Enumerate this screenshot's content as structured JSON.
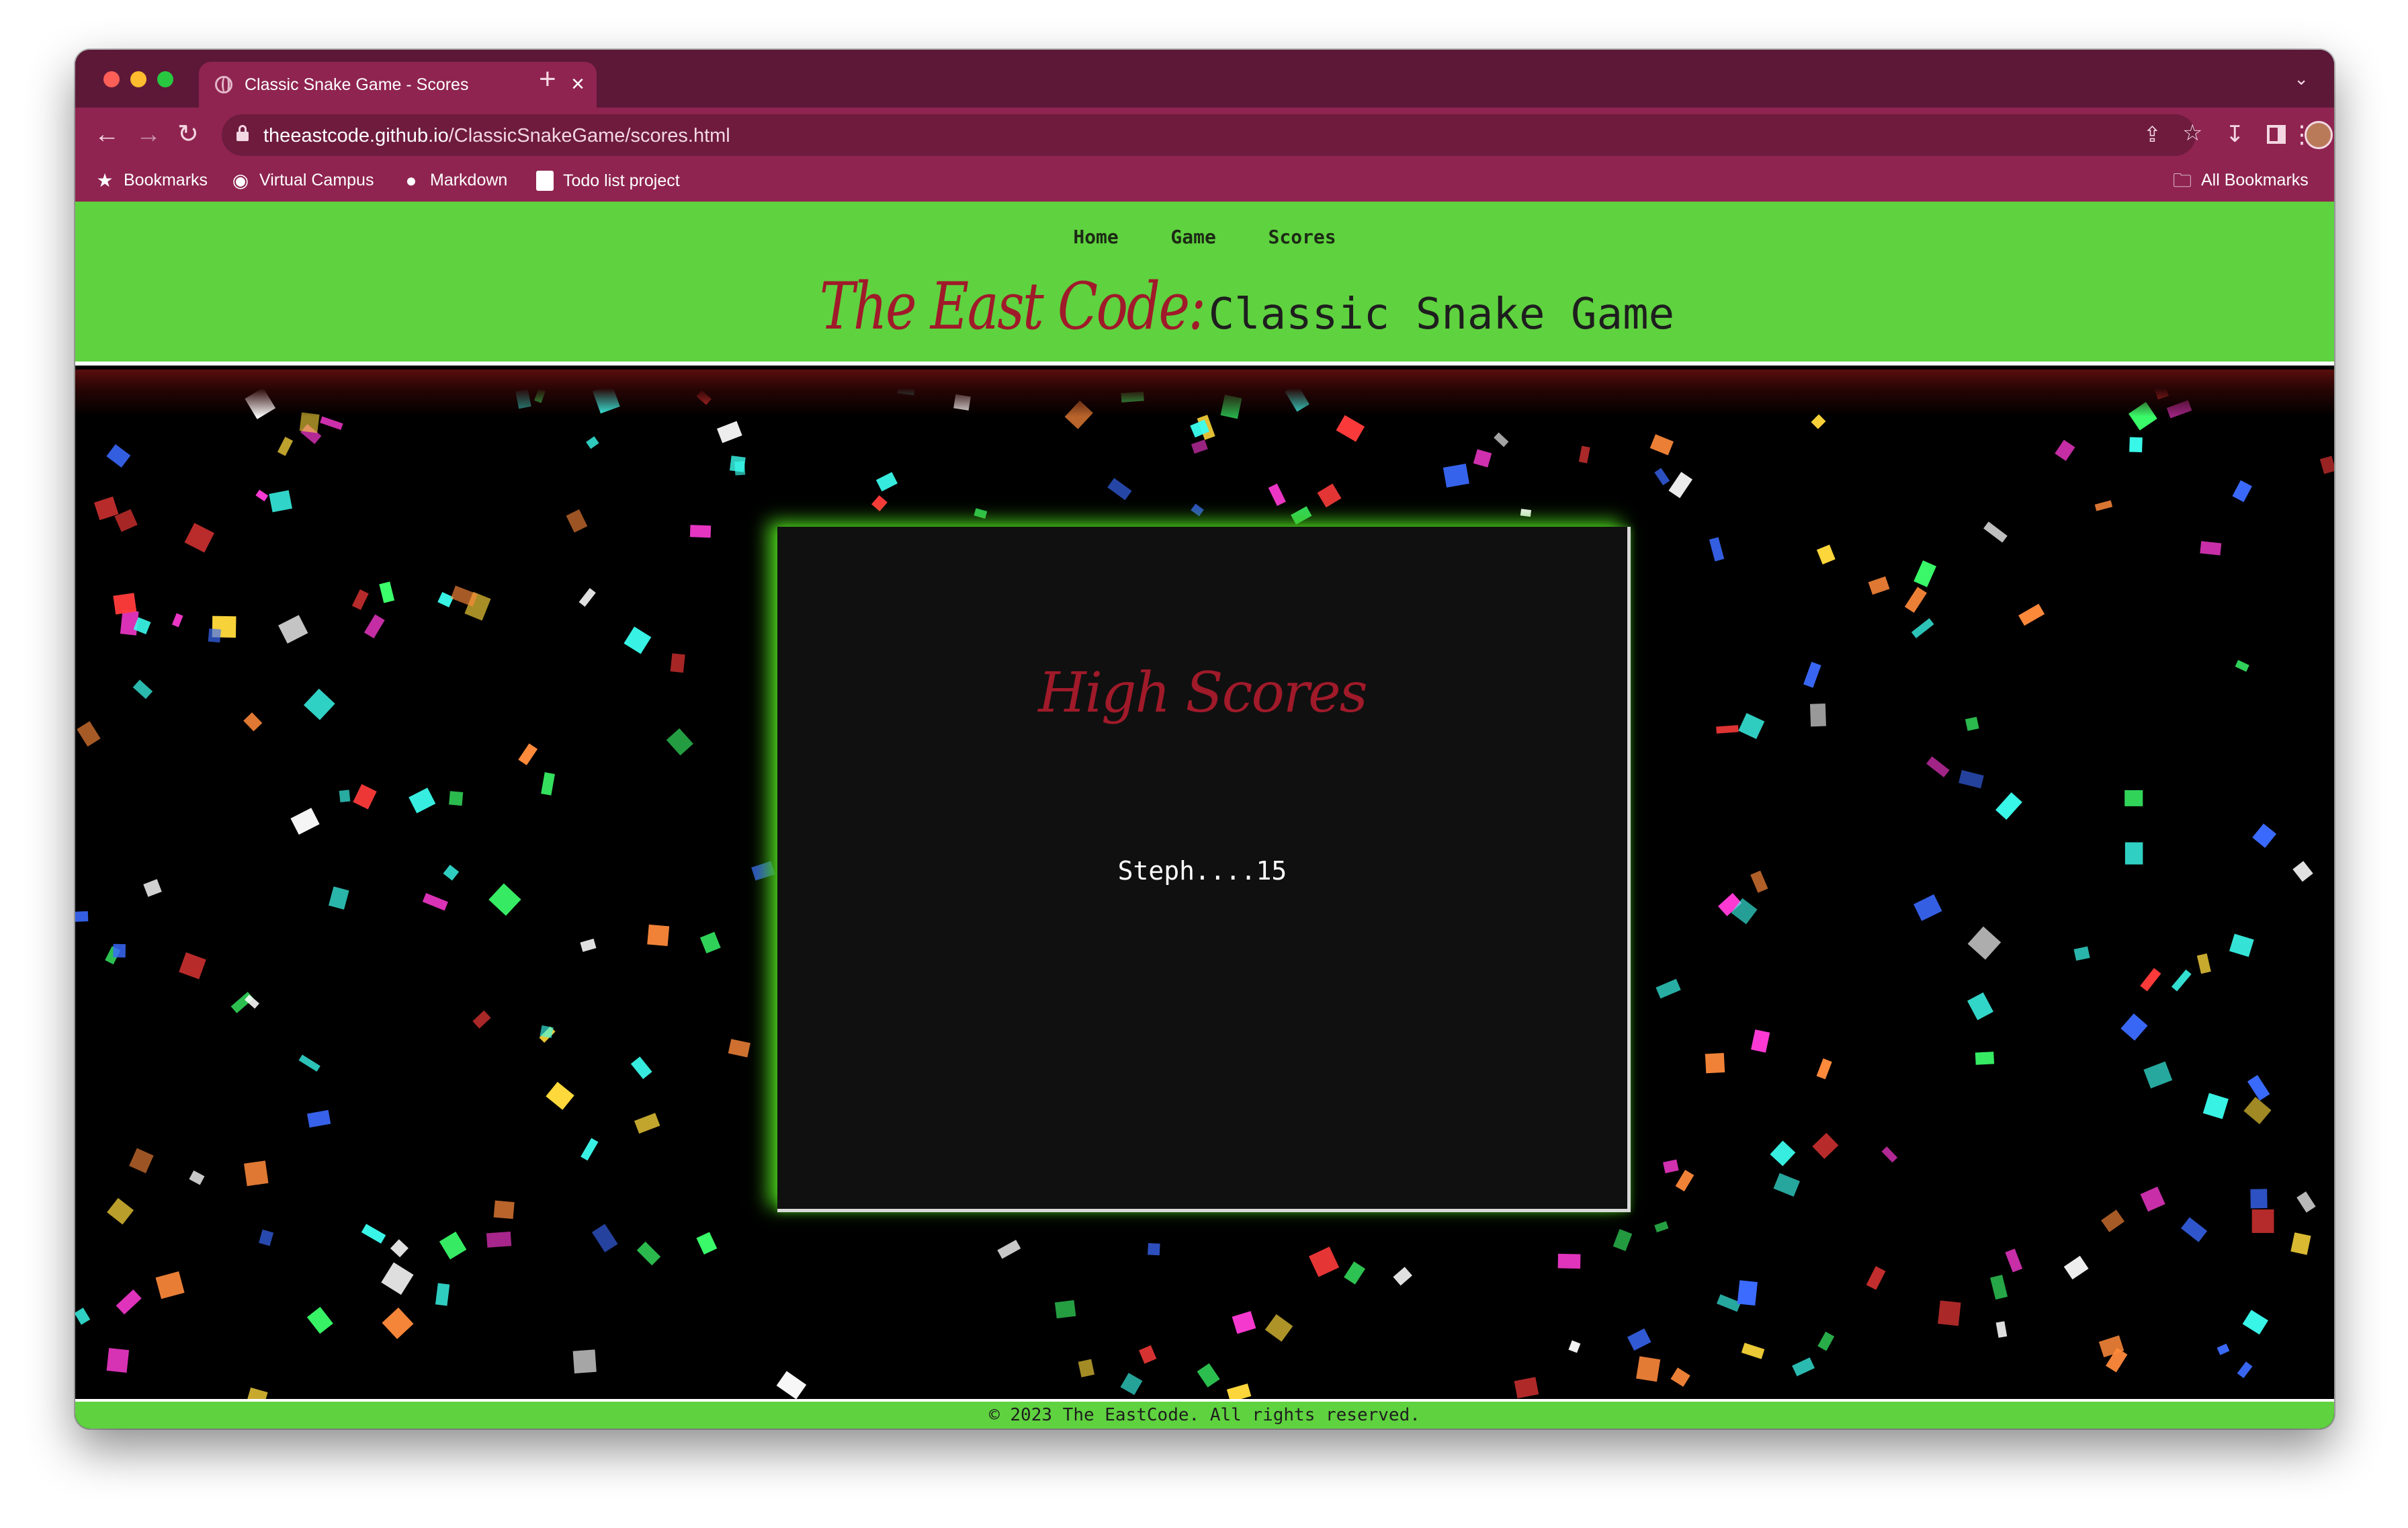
{
  "browser": {
    "tab_title": "Classic Snake Game - Scores",
    "url_host": "theeastcode.github.io",
    "url_path": "/ClassicSnakeGame/scores.html",
    "bookmarks": [
      {
        "label": "Bookmarks",
        "icon": "star-icon"
      },
      {
        "label": "Virtual Campus",
        "icon": "globe-icon"
      },
      {
        "label": "Markdown",
        "icon": "github-icon"
      },
      {
        "label": "Todo list project",
        "icon": "document-icon"
      }
    ],
    "all_bookmarks": "All Bookmarks"
  },
  "site": {
    "nav": [
      "Home",
      "Game",
      "Scores"
    ],
    "brand": "The East Code:",
    "subtitle": "Classic Snake Game",
    "scores_title": "High Scores",
    "scores": [
      "Steph....15"
    ],
    "footer": "© 2023 The EastCode. All rights reserved."
  },
  "colors": {
    "header_green": "#5fd23f",
    "brand_red": "#a01a2a",
    "browser_frame": "#8f2450"
  }
}
